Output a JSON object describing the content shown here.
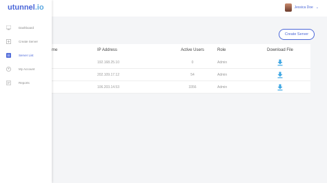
{
  "brand": {
    "name": "utunnel",
    "tld": ".io"
  },
  "user": {
    "name": "Jessica Doe"
  },
  "sidebar": {
    "items": [
      {
        "label": "Dashboard",
        "icon": "dashboard-icon",
        "active": false
      },
      {
        "label": "Create Server",
        "icon": "create-server-icon",
        "active": false
      },
      {
        "label": "Server List",
        "icon": "server-list-icon",
        "active": true
      },
      {
        "label": "My Account",
        "icon": "account-icon",
        "active": false
      },
      {
        "label": "Reports",
        "icon": "reports-icon",
        "active": false
      }
    ]
  },
  "page": {
    "title": "",
    "create_button": "Create Server"
  },
  "table": {
    "headers": [
      "me",
      "IP Address",
      "Active Users",
      "Role",
      "Download File"
    ],
    "rows": [
      {
        "name": "",
        "ip": "192.168.25.10",
        "users": "0",
        "role": "Admin"
      },
      {
        "name": "",
        "ip": "202.109.17.12",
        "users": "54",
        "role": "Admin"
      },
      {
        "name": "",
        "ip": "106.203.14.53",
        "users": "3356",
        "role": "Admin"
      }
    ]
  },
  "colors": {
    "accent": "#4a66d8",
    "download": "#3ba5e3",
    "sidebar_active": "#4a66d8"
  }
}
